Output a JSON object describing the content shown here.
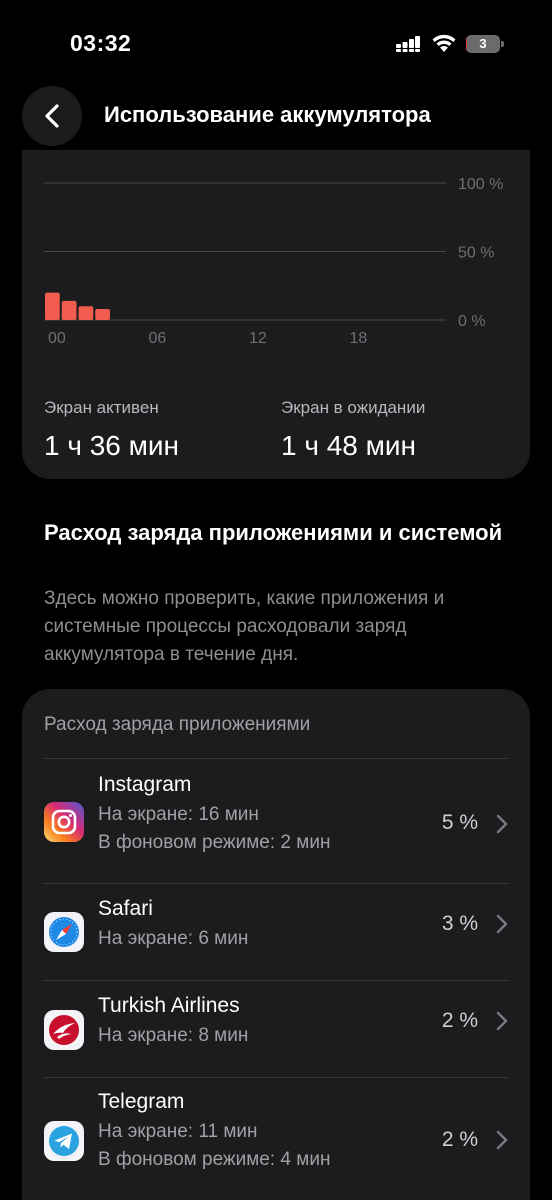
{
  "status_bar": {
    "time": "03:32",
    "battery_level": "3"
  },
  "nav": {
    "title": "Использование аккумулятора"
  },
  "chart_data": {
    "type": "bar",
    "x_tick_labels": [
      "00",
      "06",
      "12",
      "18"
    ],
    "y_tick_labels": [
      "100 %",
      "50 %",
      "0 %"
    ],
    "ylim": [
      0,
      100
    ],
    "hours": [
      0,
      1,
      2,
      3
    ],
    "values": [
      20,
      14,
      10,
      8
    ],
    "bar_color": "#f25c4f",
    "grid": true
  },
  "stats": {
    "screen_active_label": "Экран активен",
    "screen_active_value": "1 ч 36 мин",
    "screen_idle_label": "Экран в ожидании",
    "screen_idle_value": "1 ч 48 мин"
  },
  "section": {
    "title": "Расход заряда приложениями и системой",
    "description": "Здесь можно проверить, какие приложения и системные процессы расходовали заряд аккумулятора в течение дня."
  },
  "apps_card": {
    "header": "Расход заряда приложениями",
    "items": [
      {
        "name": "Instagram",
        "line1": "На экране: 16 мин",
        "line2": "В фоновом режиме: 2 мин",
        "percent": "5 %",
        "icon": "instagram-icon"
      },
      {
        "name": "Safari",
        "line1": "На экране: 6 мин",
        "line2": "",
        "percent": "3 %",
        "icon": "safari-icon"
      },
      {
        "name": "Turkish Airlines",
        "line1": "На экране: 8 мин",
        "line2": "",
        "percent": "2 %",
        "icon": "turkish-airlines-icon"
      },
      {
        "name": "Telegram",
        "line1": "На экране: 11 мин",
        "line2": "В фоновом режиме: 4 мин",
        "percent": "2 %",
        "icon": "telegram-icon"
      }
    ]
  }
}
